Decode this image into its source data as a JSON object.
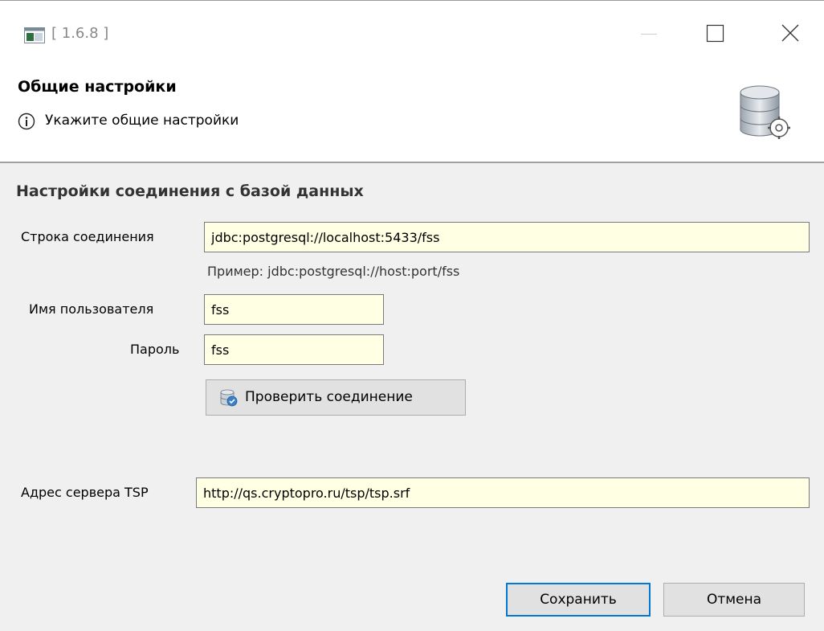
{
  "window": {
    "title": "[ 1.6.8 ]",
    "controls": {
      "minimize": "minimize",
      "maximize": "maximize",
      "close": "close"
    }
  },
  "header": {
    "title": "Общие настройки",
    "message": "Укажите общие настройки",
    "info_icon": "info-icon",
    "settings_icon": "database-settings-icon"
  },
  "db_section": {
    "title": "Настройки соединения с базой данных",
    "connection_string": {
      "label": "Строка соединения",
      "value": "jdbc:postgresql://localhost:5433/fss"
    },
    "example_hint": "Пример: jdbc:postgresql://host:port/fss",
    "username": {
      "label": "Имя пользователя",
      "value": "fss"
    },
    "password": {
      "label": "Пароль",
      "value": "fss"
    },
    "test_button": {
      "label": "Проверить соединение",
      "icon": "database-check-icon"
    }
  },
  "tsp": {
    "label": "Адрес сервера TSP",
    "value": "http://qs.cryptopro.ru/tsp/tsp.srf"
  },
  "footer": {
    "save_label": "Сохранить",
    "cancel_label": "Отмена"
  },
  "colors": {
    "input_background": "#ffffe3",
    "default_button_border": "#0078d7",
    "dialog_background": "#f0f0f0"
  }
}
